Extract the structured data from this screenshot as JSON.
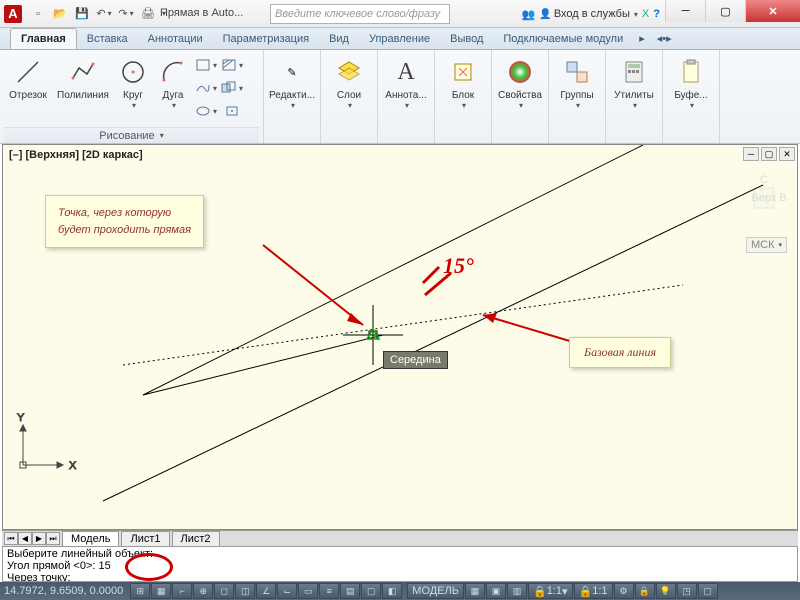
{
  "title": "Прямая в Auto...",
  "search_placeholder": "Введите ключевое слово/фразу",
  "signin": "Вход в службы",
  "tabs": [
    "Главная",
    "Вставка",
    "Аннотации",
    "Параметризация",
    "Вид",
    "Управление",
    "Вывод",
    "Подключаемые модули"
  ],
  "active_tab": 0,
  "panels": {
    "draw": {
      "title": "Рисование",
      "items": [
        {
          "label": "Отрезок"
        },
        {
          "label": "Полилиния"
        },
        {
          "label": "Круг"
        },
        {
          "label": "Дуга"
        }
      ]
    },
    "modify": {
      "title": "Редакти..."
    },
    "layers": {
      "title": "Слои"
    },
    "annot": {
      "title": "Аннота..."
    },
    "block": {
      "title": "Блок"
    },
    "props": {
      "title": "Свойства"
    },
    "groups": {
      "title": "Группы"
    },
    "utils": {
      "title": "Утилиты"
    },
    "clip": {
      "title": "Буфе..."
    }
  },
  "viewport_label": "[–] [Верхняя] [2D каркас]",
  "callout1": "Точка, через которую\nбудет проходить прямая",
  "callout2": "Базовая линия",
  "angle_text": "15°",
  "snap_label": "Середина",
  "ucs_label": "МСК",
  "model_tabs": {
    "items": [
      "Модель",
      "Лист1",
      "Лист2"
    ],
    "active": 0
  },
  "cmd_lines": [
    "Выберите линейный объект:",
    "Угол прямой <0>: 15",
    "Через точку:"
  ],
  "status": {
    "coords": "14.7972, 9.6509, 0.0000",
    "model": "МОДЕЛЬ",
    "scale": "1:1",
    "const": "1:1"
  }
}
